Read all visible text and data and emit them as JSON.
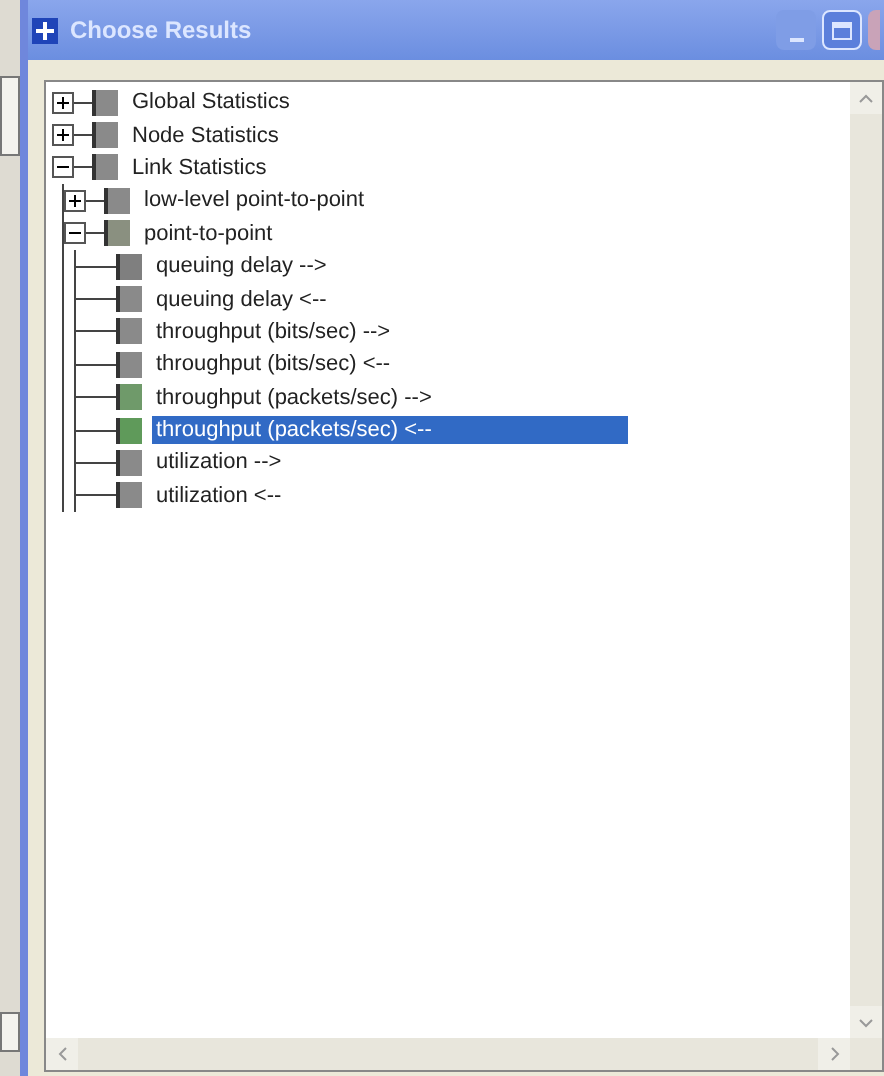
{
  "window": {
    "title": "Choose Results"
  },
  "tree": [
    {
      "kind": "folder",
      "label": "Global Statistics",
      "expanded": false,
      "selected": false,
      "color": "#8a8a8a"
    },
    {
      "kind": "folder",
      "label": "Node Statistics",
      "expanded": false,
      "selected": false,
      "color": "#8a8a8a"
    },
    {
      "kind": "folder",
      "label": "Link Statistics",
      "expanded": true,
      "selected": false,
      "color": "#8a8a8a",
      "children": [
        {
          "kind": "folder",
          "label": "low-level point-to-point",
          "expanded": false,
          "selected": false,
          "color": "#8a8a8a"
        },
        {
          "kind": "folder",
          "label": "point-to-point",
          "expanded": true,
          "selected": false,
          "color": "#8a9080",
          "children": [
            {
              "kind": "leaf",
              "label": "queuing delay -->",
              "selected": false,
              "color": "#7f7f7f"
            },
            {
              "kind": "leaf",
              "label": "queuing delay <--",
              "selected": false,
              "color": "#8a8a8a"
            },
            {
              "kind": "leaf",
              "label": "throughput (bits/sec) -->",
              "selected": false,
              "color": "#8a8a8a"
            },
            {
              "kind": "leaf",
              "label": "throughput (bits/sec) <--",
              "selected": false,
              "color": "#8a8a8a"
            },
            {
              "kind": "leaf",
              "label": "throughput (packets/sec) -->",
              "selected": false,
              "color": "#6f9a6a"
            },
            {
              "kind": "leaf",
              "label": "throughput (packets/sec) <--",
              "selected": true,
              "color": "#5f9a5a"
            },
            {
              "kind": "leaf",
              "label": "utilization -->",
              "selected": false,
              "color": "#8a8a8a"
            },
            {
              "kind": "leaf",
              "label": "utilization <--",
              "selected": false,
              "color": "#8a8a8a"
            }
          ]
        }
      ]
    }
  ]
}
